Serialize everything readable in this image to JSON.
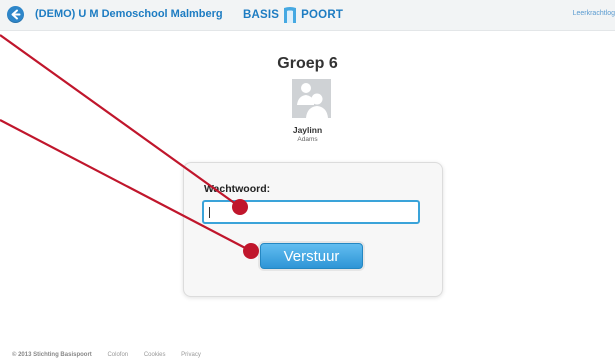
{
  "header": {
    "back_icon": "arrow-left-icon",
    "school_name": "(DEMO) U M Demoschool Malmberg",
    "brand_left": "BASIS",
    "brand_right": "POORT",
    "brand_icon": "door-logo-icon",
    "teacher_login": "Leerkrachtlog"
  },
  "main": {
    "group_title": "Groep 6",
    "avatar_icon": "users-avatar-icon",
    "user_first_name": "Jaylinn",
    "user_last_name": "Adams"
  },
  "login": {
    "password_label": "Wachtwoord:",
    "password_value": "",
    "submit_label": "Verstuur"
  },
  "footer": {
    "copyright": "© 2013 Stichting Basispoort",
    "links": [
      "Colofon",
      "Cookies",
      "Privacy"
    ]
  },
  "colors": {
    "brand_blue": "#1d7cc2",
    "button_blue": "#2e95d6",
    "input_border": "#3aa3d9",
    "annotation_red": "#c0162c"
  }
}
